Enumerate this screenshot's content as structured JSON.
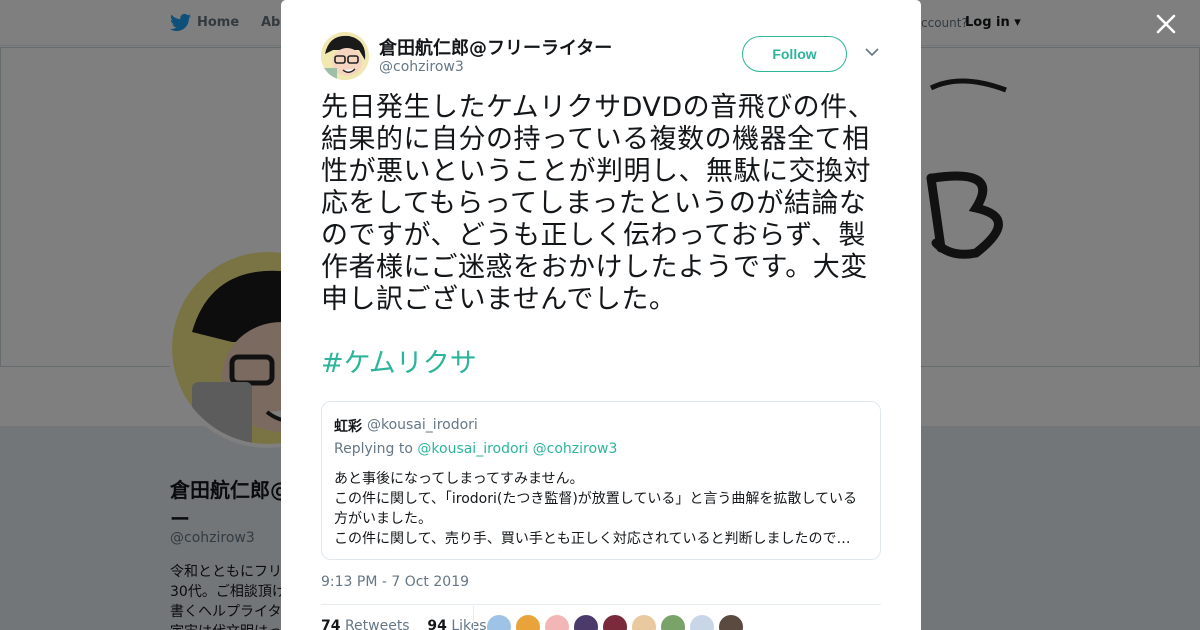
{
  "header": {
    "home_label": "Home",
    "about_label": "Abo",
    "account_prompt": "ccount?",
    "login_label": "Log in"
  },
  "profile": {
    "name": "倉田航仁郎@",
    "name_line2": "ー",
    "handle": "@cohzirow3",
    "bio_lines": [
      "令和とともにフリ",
      "30代。ご相談頂け",
      "書くヘルプライタ",
      "宇宙は代文明はっ"
    ]
  },
  "tweet": {
    "author_name": "倉田航仁郎@フリーライター",
    "author_handle": "@cohzirow3",
    "follow_label": "Follow",
    "text": "先日発生したケムリクサDVDの音飛びの件、結果的に自分の持っている複数の機器全て相性が悪いということが判明し、無駄に交換対応をしてもらってしまったというのが結論なのですが、どうも正しく伝わっておらず、製作者様にご迷惑をおかけしたようです。大変申し訳ございませんでした。",
    "hashtag": "#ケムリクサ",
    "timestamp": "9:13 PM - 7 Oct 2019",
    "retweets_count": "74",
    "retweets_label": "Retweets",
    "likes_count": "94",
    "likes_label": "Likes"
  },
  "quoted": {
    "name": "虹彩",
    "handle": "@kousai_irodori",
    "replying_prefix": "Replying to",
    "replying_to_1": "@kousai_irodori",
    "replying_to_2": "@cohzirow3",
    "line1": "あと事後になってしまってすみません。",
    "line2": "この件に関して、「irodori(たつき監督)が放置している」と言う曲解を拡散している",
    "line3": "方がいました。",
    "line4": "この件に関して、売り手、買い手とも正しく対応されていると判断しましたので…"
  },
  "colors": {
    "accent": "#2db59b",
    "text": "#14171a",
    "muted": "#657786"
  },
  "likers": [
    "#9fc3e6",
    "#e8a33a",
    "#f3b6b6",
    "#4b3b6b",
    "#7a2a3a",
    "#e8c9a0",
    "#7aa36a",
    "#c9d6e8",
    "#5a4a40"
  ]
}
